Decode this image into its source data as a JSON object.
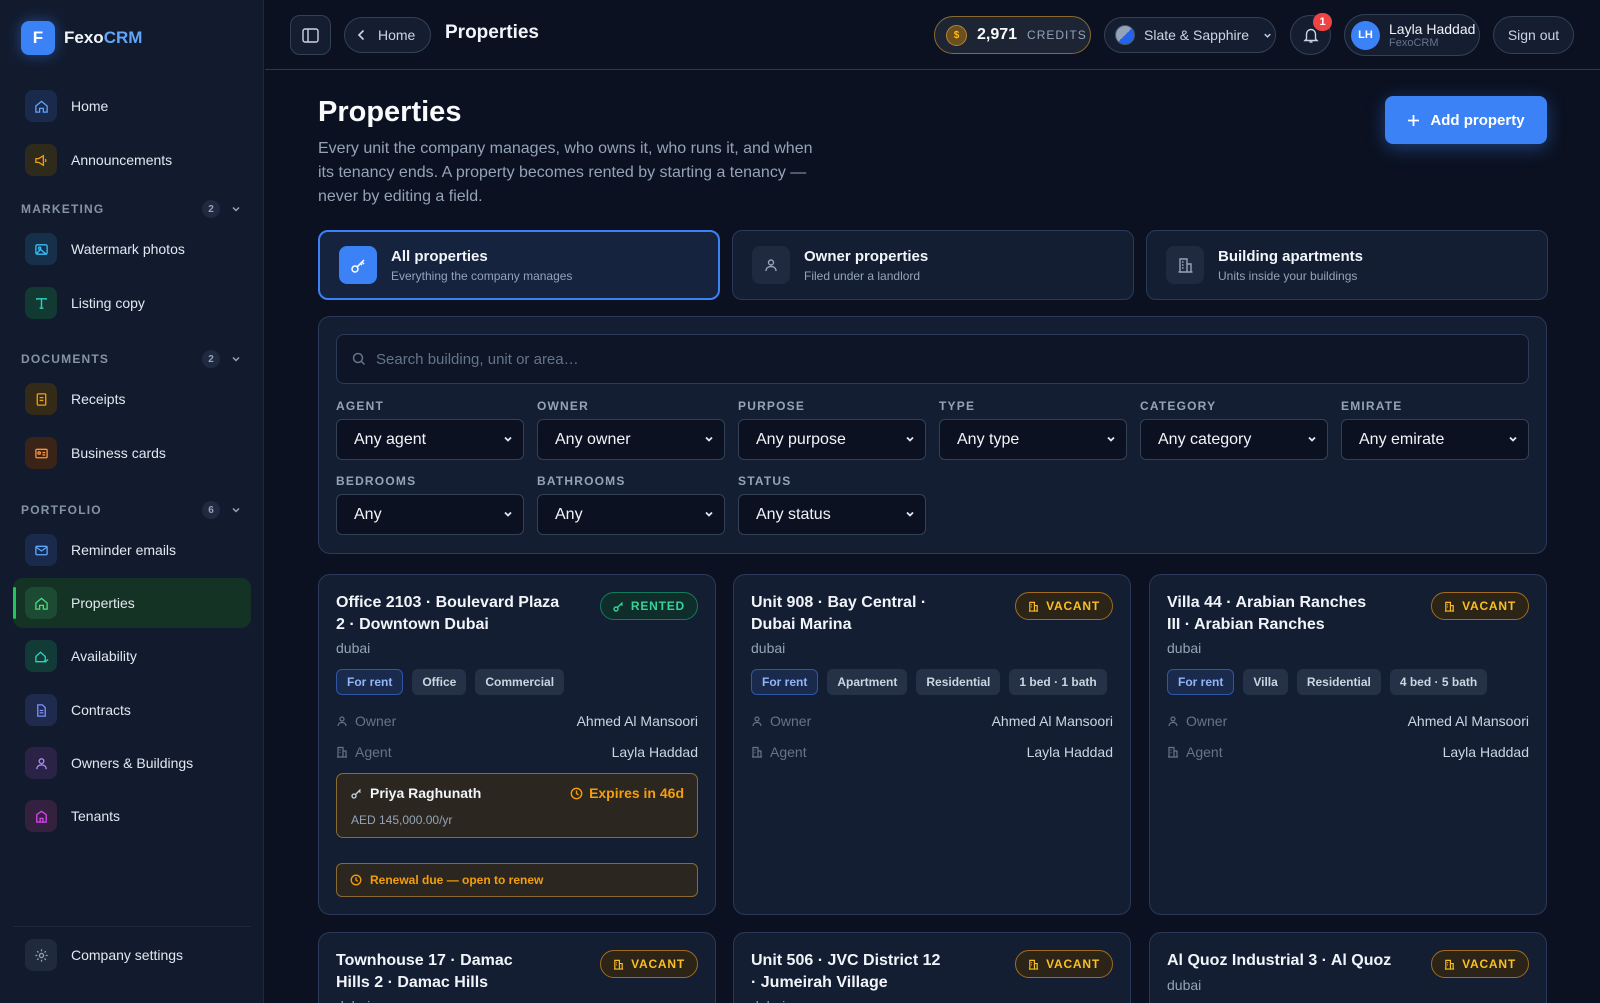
{
  "brand": {
    "logo_letter": "F",
    "name_part1": "Fexo",
    "name_part2": "CRM"
  },
  "sidebar": {
    "items_top": [
      {
        "label": "Home",
        "icon": "home-icon"
      },
      {
        "label": "Announcements",
        "icon": "megaphone-icon"
      }
    ],
    "sections": [
      {
        "title": "MARKETING",
        "count": "2",
        "items": [
          {
            "label": "Watermark photos",
            "icon": "image-icon"
          },
          {
            "label": "Listing copy",
            "icon": "type-icon"
          }
        ]
      },
      {
        "title": "DOCUMENTS",
        "count": "2",
        "items": [
          {
            "label": "Receipts",
            "icon": "receipt-icon"
          },
          {
            "label": "Business cards",
            "icon": "id-card-icon"
          }
        ]
      },
      {
        "title": "PORTFOLIO",
        "count": "6",
        "items": [
          {
            "label": "Reminder emails",
            "icon": "mail-icon"
          },
          {
            "label": "Properties",
            "icon": "house-icon",
            "active": true
          },
          {
            "label": "Availability",
            "icon": "availability-icon"
          },
          {
            "label": "Contracts",
            "icon": "file-icon"
          },
          {
            "label": "Owners & Buildings",
            "icon": "user-icon"
          },
          {
            "label": "Tenants",
            "icon": "building-icon"
          }
        ]
      }
    ],
    "footer_item": {
      "label": "Company settings",
      "icon": "gear-icon"
    }
  },
  "topbar": {
    "home_label": "Home",
    "title": "Properties",
    "credits_value": "2,971",
    "credits_label": "CREDITS",
    "theme_label": "Slate & Sapphire",
    "notifications_count": "1",
    "user_initials": "LH",
    "user_name": "Layla Haddad",
    "user_org": "FexoCRM",
    "signout_label": "Sign out"
  },
  "page": {
    "title": "Properties",
    "description": "Every unit the company manages, who owns it, who runs it, and when its tenancy ends. A property becomes rented by starting a tenancy — never by editing a field.",
    "add_button": "Add property"
  },
  "scopes": [
    {
      "title": "All properties",
      "subtitle": "Everything the company manages",
      "active": true
    },
    {
      "title": "Owner properties",
      "subtitle": "Filed under a landlord"
    },
    {
      "title": "Building apartments",
      "subtitle": "Units inside your buildings"
    }
  ],
  "filters": {
    "search_placeholder": "Search building, unit or area…",
    "fields": [
      {
        "label": "AGENT",
        "value": "Any agent"
      },
      {
        "label": "OWNER",
        "value": "Any owner"
      },
      {
        "label": "PURPOSE",
        "value": "Any purpose"
      },
      {
        "label": "TYPE",
        "value": "Any type"
      },
      {
        "label": "CATEGORY",
        "value": "Any category"
      },
      {
        "label": "EMIRATE",
        "value": "Any emirate"
      },
      {
        "label": "BEDROOMS",
        "value": "Any"
      },
      {
        "label": "BATHROOMS",
        "value": "Any"
      },
      {
        "label": "STATUS",
        "value": "Any status"
      }
    ]
  },
  "properties": [
    {
      "title": "Office 2103 · Boulevard Plaza 2 · Downtown Dubai",
      "city": "dubai",
      "status": "RENTED",
      "tags": [
        "For rent",
        "Office",
        "Commercial"
      ],
      "owner_label": "Owner",
      "owner": "Ahmed Al Mansoori",
      "agent_label": "Agent",
      "agent": "Layla Haddad",
      "tenant": "Priya Raghunath",
      "expires": "Expires in 46d",
      "rent": "AED 145,000.00/yr",
      "renewal": "Renewal due — open to renew"
    },
    {
      "title": "Unit 908 · Bay Central · Dubai Marina",
      "city": "dubai",
      "status": "VACANT",
      "tags": [
        "For rent",
        "Apartment",
        "Residential",
        "1 bed · 1 bath"
      ],
      "owner_label": "Owner",
      "owner": "Ahmed Al Mansoori",
      "agent_label": "Agent",
      "agent": "Layla Haddad"
    },
    {
      "title": "Villa 44 · Arabian Ranches III · Arabian Ranches",
      "city": "dubai",
      "status": "VACANT",
      "tags": [
        "For rent",
        "Villa",
        "Residential",
        "4 bed · 5 bath"
      ],
      "owner_label": "Owner",
      "owner": "Ahmed Al Mansoori",
      "agent_label": "Agent",
      "agent": "Layla Haddad"
    },
    {
      "title": "Townhouse 17 · Damac Hills 2 · Damac Hills",
      "city": "dubai",
      "status": "VACANT"
    },
    {
      "title": "Unit 506 · JVC District 12 · Jumeirah Village",
      "city": "dubai",
      "status": "VACANT"
    },
    {
      "title": "Al Quoz Industrial 3 · Al Quoz",
      "city": "dubai",
      "status": "VACANT"
    }
  ],
  "colors": {
    "accent": "#3b82f6",
    "rented": "#34d399",
    "vacant": "#fbbf24",
    "background": "#0b1120"
  }
}
